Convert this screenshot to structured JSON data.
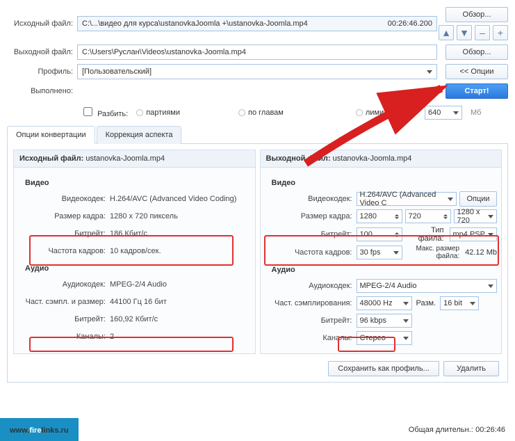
{
  "labels": {
    "source": "Исходный файл:",
    "output": "Выходной файл:",
    "profile": "Профиль:",
    "done": "Выполнено:"
  },
  "source_path": "C:\\...\\видео для курса\\ustanovkaJoomla +\\ustanovka-Joomla.mp4",
  "source_dur": "00:26:46.200",
  "output_path": "C:\\Users\\Руслан\\Videos\\ustanovka-Joomla.mp4",
  "profile_val": "[Пользовательский]",
  "btns": {
    "browse": "Обзор...",
    "options": "<< Опции",
    "start": "Старт!",
    "opts": "Опции",
    "save_profile": "Сохранить как профиль...",
    "delete": "Удалить"
  },
  "split": {
    "label": "Разбить:",
    "batch": "партиями",
    "chapters": "по главам",
    "limit": "лимит. размер",
    "size": "640",
    "mb": "Мб"
  },
  "tabs": {
    "conv": "Опции конвертации",
    "aspect": "Коррекция аспекта"
  },
  "src": {
    "hdr": "Исходный файл:",
    "file": "ustanovka-Joomla.mp4",
    "video": "Видео",
    "codec_l": "Видеокодек:",
    "codec": "H.264/AVC (Advanced Video Coding)",
    "frame_l": "Размер кадра:",
    "frame": "1280 x 720 пиксель",
    "bitrate_l": "Битрейт:",
    "bitrate": "186 Кбит/с",
    "fps_l": "Частота кадров:",
    "fps": "10 кадров/сек.",
    "audio": "Аудио",
    "acodec_l": "Аудиокодек:",
    "acodec": "MPEG-2/4 Audio",
    "asamp_l": "Част. сэмпл. и размер:",
    "asamp": "44100 Гц 16 бит",
    "abit_l": "Битрейт:",
    "abit": "160,92 Кбит/с",
    "chan_l": "Каналы:",
    "chan": "2"
  },
  "out": {
    "hdr": "Выходной файл:",
    "file": "ustanovka-Joomla.mp4",
    "video": "Видео",
    "codec_l": "Видеокодек:",
    "codec": "H.264/AVC (Advanced Video C",
    "frame_l": "Размер кадра:",
    "w": "1280",
    "h": "720",
    "preset": "1280 x 720",
    "bitrate_l": "Битрейт:",
    "bitrate": "100",
    "ftype_l": "Тип файла:",
    "ftype": "mp4 PSP",
    "fps_l": "Частота кадров:",
    "fps": "30 fps",
    "maxsize_l": "Макс. размер файла:",
    "maxsize": "42.12 Mb",
    "audio": "Аудио",
    "acodec_l": "Аудиокодек:",
    "acodec": "MPEG-2/4 Audio",
    "asamp_l": "Част. сэмплирования:",
    "asamp": "48000 Hz",
    "asize_l": "Разм.",
    "asize": "16 bit",
    "abit_l": "Битрейт:",
    "abit": "96 kbps",
    "chan_l": "Каналы:",
    "chan": "Стерео"
  },
  "status": {
    "total_l": "Общая длительн.:",
    "total": "00:26:46"
  },
  "brand": {
    "a": "www.",
    "b": "fire",
    "c": "links.ru"
  }
}
